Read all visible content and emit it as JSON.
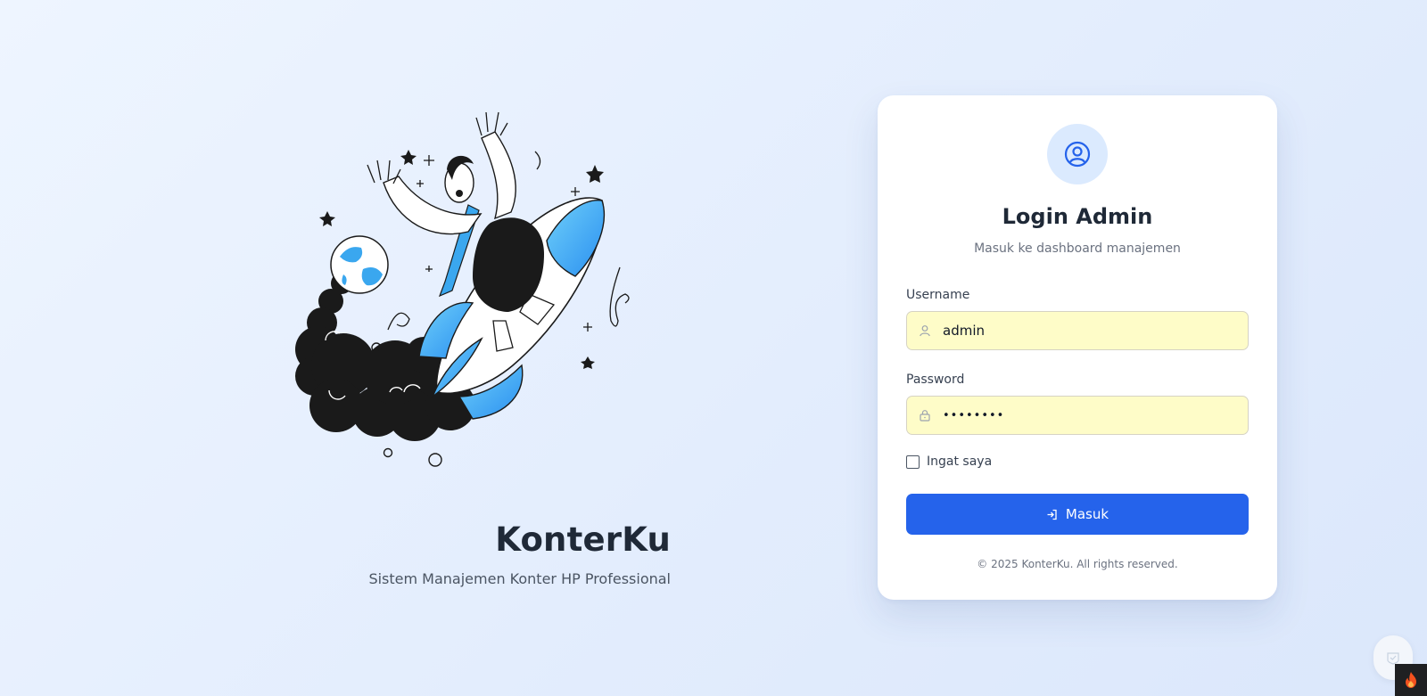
{
  "brand": {
    "title": "KonterKu",
    "subtitle": "Sistem Manajemen Konter HP Professional"
  },
  "login": {
    "title": "Login Admin",
    "subtitle": "Masuk ke dashboard manajemen",
    "username_label": "Username",
    "username_value": "admin",
    "password_label": "Password",
    "password_value": "••••••••",
    "remember_label": "Ingat saya",
    "remember_checked": false,
    "submit_label": "Masuk",
    "copyright": "© 2025 KonterKu. All rights reserved."
  },
  "icons": {
    "avatar": "user-circle-icon",
    "username": "user-icon",
    "password": "lock-icon",
    "submit": "login-icon",
    "float_widget": "shield-check-icon",
    "debug_badge": "flame-icon"
  },
  "colors": {
    "primary": "#2563eb",
    "avatar_bg": "#dbeafe",
    "input_autofill_bg": "#fefcc8",
    "text_dark": "#1f2937",
    "text_muted": "#6b7280",
    "illustration_blue": "#3aa7ef",
    "illustration_black": "#1a1a1a"
  }
}
